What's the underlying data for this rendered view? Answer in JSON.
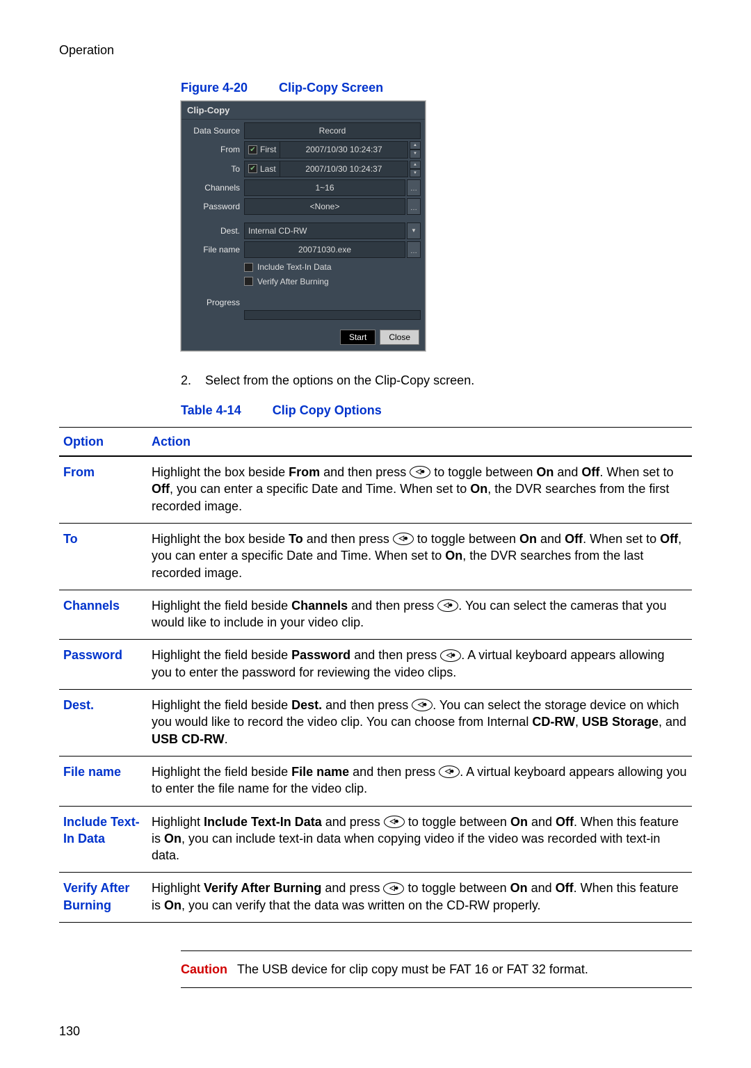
{
  "header": {
    "crumb": "Operation"
  },
  "figure": {
    "label": "Figure 4-20",
    "title": "Clip-Copy Screen"
  },
  "dvr": {
    "title": "Clip-Copy",
    "labels": {
      "data_source": "Data Source",
      "from": "From",
      "to": "To",
      "channels": "Channels",
      "password": "Password",
      "dest": "Dest.",
      "file_name": "File name",
      "progress": "Progress"
    },
    "values": {
      "data_source": "Record",
      "from_cb": "First",
      "from_dt": "2007/10/30  10:24:37",
      "to_cb": "Last",
      "to_dt": "2007/10/30  10:24:37",
      "channels": "1~16",
      "password": "<None>",
      "dest": "Internal CD-RW",
      "file_name": "20071030.exe",
      "include_text": "Include Text-In Data",
      "verify_after": "Verify After Burning"
    },
    "buttons": {
      "start": "Start",
      "close": "Close"
    }
  },
  "step": {
    "num": "2.",
    "text": "Select from the options on the Clip-Copy screen."
  },
  "table_caption": {
    "label": "Table 4-14",
    "title": "Clip Copy Options"
  },
  "table": {
    "head_option": "Option",
    "head_action": "Action",
    "rows": {
      "from": {
        "opt": "From",
        "p1a": "Highlight the box beside ",
        "p1b": "From",
        "p1c": " and then press ",
        "p1d": " to toggle between ",
        "p1e": "On",
        "p1f": " and ",
        "p1g": "Off",
        "p1h": ". When set to ",
        "p1i": "Off",
        "p1j": ", you can enter a specific Date and Time. When set to ",
        "p1k": "On",
        "p1l": ", the DVR searches from the first recorded image."
      },
      "to": {
        "opt": "To",
        "p1a": "Highlight the box beside ",
        "p1b": "To",
        "p1c": " and then press ",
        "p1d": " to toggle between ",
        "p1e": "On",
        "p1f": " and ",
        "p1g": "Off",
        "p1h": ". When set to ",
        "p1i": "Off",
        "p1j": ", you can enter a specific Date and Time. When set to ",
        "p1k": "On",
        "p1l": ", the DVR searches from the last recorded image."
      },
      "channels": {
        "opt": "Channels",
        "p1a": "Highlight the field beside ",
        "p1b": "Channels",
        "p1c": " and then press ",
        "p1d": ". You can select the cameras that you would like to include in your video clip."
      },
      "password": {
        "opt": "Password",
        "p1a": "Highlight the field beside ",
        "p1b": "Password",
        "p1c": " and then press ",
        "p1d": ". A virtual keyboard appears allowing you to enter the password for reviewing the video clips."
      },
      "dest": {
        "opt": "Dest.",
        "p1a": "Highlight the field beside ",
        "p1b": "Dest.",
        "p1c": " and then press ",
        "p1d": ". You can select the storage device on which you would like to record the video clip. You can choose from Internal ",
        "p1e": "CD-RW",
        "p1f": ", ",
        "p1g": "USB Storage",
        "p1h": ", and ",
        "p1i": "USB CD-RW",
        "p1j": "."
      },
      "filename": {
        "opt": "File name",
        "p1a": "Highlight the field beside ",
        "p1b": "File name",
        "p1c": " and then press ",
        "p1d": ". A virtual keyboard appears allowing you to enter the file name for the video clip."
      },
      "include": {
        "opt": "Include Text-In Data",
        "p1a": "Highlight ",
        "p1b": "Include Text-In Data",
        "p1c": " and press ",
        "p1d": " to toggle between ",
        "p1e": "On",
        "p1f": " and ",
        "p1g": "Off",
        "p1h": ". When this feature is ",
        "p1i": "On",
        "p1j": ", you can include text-in data when copying video if the video was recorded with text-in data."
      },
      "verify": {
        "opt": "Verify After Burning",
        "p1a": "Highlight ",
        "p1b": "Verify After Burning",
        "p1c": " and press ",
        "p1d": " to toggle between ",
        "p1e": "On",
        "p1f": " and ",
        "p1g": "Off",
        "p1h": ". When this feature is ",
        "p1i": "On",
        "p1j": ", you can verify that the data was written on the CD-RW properly."
      }
    }
  },
  "caution": {
    "label": "Caution",
    "text": "The USB device for clip copy must be FAT 16 or FAT 32 format."
  },
  "page_number": "130",
  "enter_icon_glyph": "◁⦁"
}
